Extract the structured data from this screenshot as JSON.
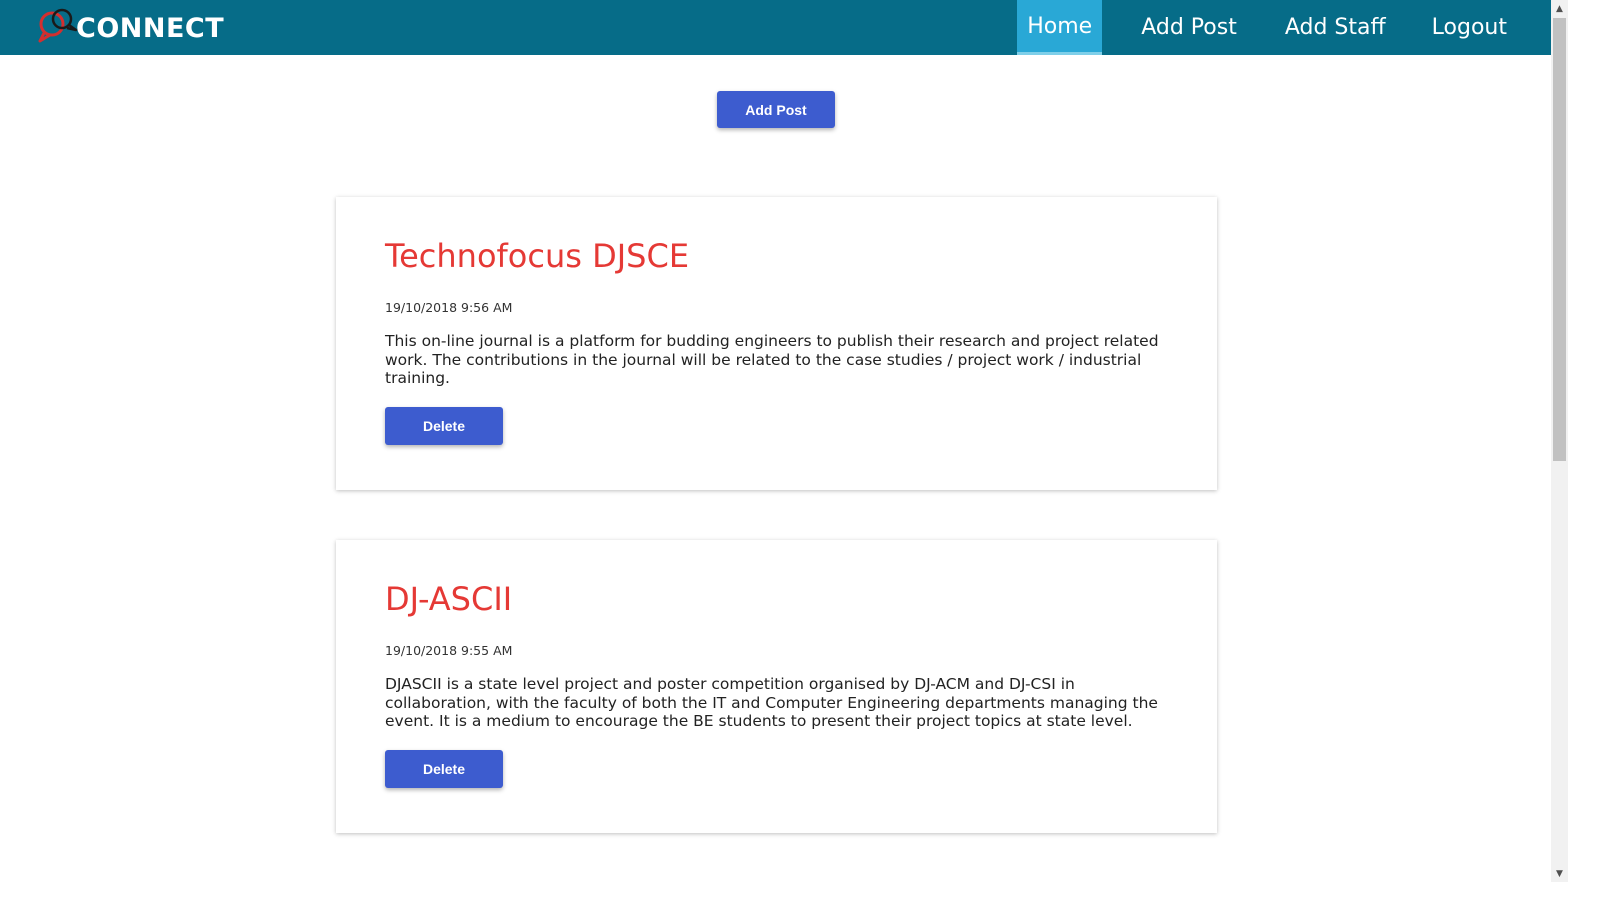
{
  "navbar": {
    "brand": "CONNECT",
    "logo_icon": "chat-bubbles-icon",
    "links": [
      {
        "label": "Home",
        "active": true
      },
      {
        "label": "Add Post",
        "active": false
      },
      {
        "label": "Add Staff",
        "active": false
      },
      {
        "label": "Logout",
        "active": false
      }
    ]
  },
  "main": {
    "add_post_label": "Add Post",
    "posts": [
      {
        "title": "Technofocus DJSCE",
        "date": "19/10/2018 9:56 AM",
        "body": "This on-line journal is a platform for budding engineers to publish their research and project related work. The contributions in the journal will be related to the case studies / project work / industrial training.",
        "delete_label": "Delete"
      },
      {
        "title": "DJ-ASCII",
        "date": "19/10/2018 9:55 AM",
        "body": "DJASCII is a state level project and poster competition organised by DJ-ACM and DJ-CSI in collaboration, with the faculty of both the IT and Computer Engineering departments managing the event. It is a medium to encourage the BE students to present their project topics at state level.",
        "delete_label": "Delete"
      }
    ]
  },
  "colors": {
    "navbar": "#066c88",
    "nav_active": "#29a8d6",
    "button": "#3d5ccf",
    "title": "#e53935",
    "logo": "#d32f2f"
  }
}
